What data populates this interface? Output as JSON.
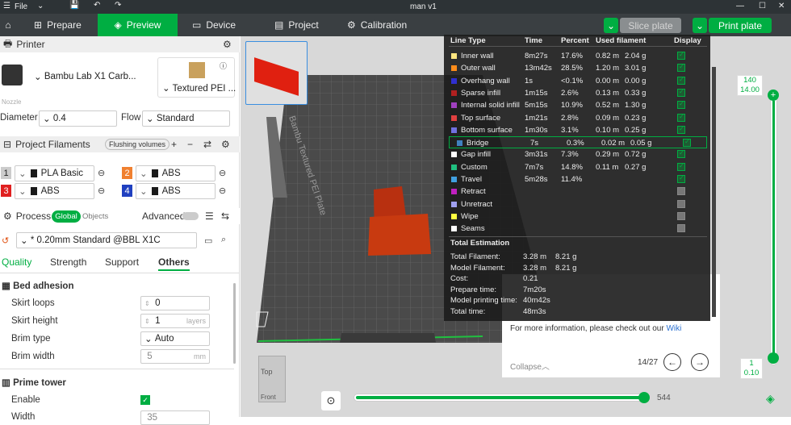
{
  "titlebar": {
    "file": "File",
    "project_name": "man v1"
  },
  "tabs": {
    "prepare": "Prepare",
    "preview": "Preview",
    "device": "Device",
    "project": "Project",
    "calibration": "Calibration"
  },
  "actions": {
    "slice": "Slice plate",
    "print": "Print plate"
  },
  "printer": {
    "section": "Printer",
    "name": "Bambu Lab X1 Carb...",
    "plate": "Textured PEI ...",
    "nozzle_label": "Nozzle",
    "diameter_label": "Diameter",
    "diameter": "0.4",
    "flow_label": "Flow",
    "flow": "Standard"
  },
  "filaments": {
    "section": "Project Filaments",
    "flushing": "Flushing volumes",
    "items": [
      {
        "num": "1",
        "name": "PLA Basic",
        "color": "#1a1a1a",
        "numbg": "#cccccc",
        "numfg": "#222222"
      },
      {
        "num": "2",
        "name": "ABS",
        "color": "#1a1a1a",
        "numbg": "#f08030",
        "numfg": "#ffffff"
      },
      {
        "num": "3",
        "name": "ABS",
        "color": "#1a1a1a",
        "numbg": "#e02020",
        "numfg": "#ffffff"
      },
      {
        "num": "4",
        "name": "ABS",
        "color": "#1a1a1a",
        "numbg": "#2040c0",
        "numfg": "#ffffff"
      }
    ]
  },
  "process": {
    "section": "Process",
    "global": "Global",
    "objects": "Objects",
    "advanced": "Advanced",
    "profile": "* 0.20mm Standard @BBL X1C",
    "tabs": [
      "Quality",
      "Strength",
      "Support",
      "Others"
    ]
  },
  "bed": {
    "section": "Bed adhesion",
    "skirt_loops_label": "Skirt loops",
    "skirt_loops": "0",
    "skirt_height_label": "Skirt height",
    "skirt_height": "1",
    "skirt_height_unit": "layers",
    "brim_type_label": "Brim type",
    "brim_type": "Auto",
    "brim_width_label": "Brim width",
    "brim_width": "5",
    "brim_width_unit": "mm"
  },
  "prime": {
    "section": "Prime tower",
    "enable_label": "Enable",
    "width_label": "Width",
    "width": "35"
  },
  "plate_label": "Bambu Textured PEI Plate",
  "stats": {
    "headers": [
      "Line Type",
      "Time",
      "Percent",
      "Used filament",
      "Display"
    ],
    "rows": [
      {
        "name": "Inner wall",
        "time": "8m27s",
        "pct": "17.6%",
        "len": "0.82 m",
        "g": "2.04 g",
        "color": "#ffe680"
      },
      {
        "name": "Outer wall",
        "time": "13m42s",
        "pct": "28.5%",
        "len": "1.20 m",
        "g": "3.01 g",
        "color": "#ff8c1a"
      },
      {
        "name": "Overhang wall",
        "time": "1s",
        "pct": "<0.1%",
        "len": "0.00 m",
        "g": "0.00 g",
        "color": "#3030d0"
      },
      {
        "name": "Sparse infill",
        "time": "1m15s",
        "pct": "2.6%",
        "len": "0.13 m",
        "g": "0.33 g",
        "color": "#b02020"
      },
      {
        "name": "Internal solid infill",
        "time": "5m15s",
        "pct": "10.9%",
        "len": "0.52 m",
        "g": "1.30 g",
        "color": "#a040c0"
      },
      {
        "name": "Top surface",
        "time": "1m21s",
        "pct": "2.8%",
        "len": "0.09 m",
        "g": "0.23 g",
        "color": "#e04040"
      },
      {
        "name": "Bottom surface",
        "time": "1m30s",
        "pct": "3.1%",
        "len": "0.10 m",
        "g": "0.25 g",
        "color": "#7070e0"
      },
      {
        "name": "Bridge",
        "time": "7s",
        "pct": "0.3%",
        "len": "0.02 m",
        "g": "0.05 g",
        "color": "#4080c0"
      },
      {
        "name": "Gap infill",
        "time": "3m31s",
        "pct": "7.3%",
        "len": "0.29 m",
        "g": "0.72 g",
        "color": "#ffffff"
      },
      {
        "name": "Custom",
        "time": "7m7s",
        "pct": "14.8%",
        "len": "0.11 m",
        "g": "0.27 g",
        "color": "#20c080"
      },
      {
        "name": "Travel",
        "time": "5m28s",
        "pct": "11.4%",
        "len": "",
        "g": "",
        "color": "#40a0e0"
      },
      {
        "name": "Retract",
        "time": "",
        "pct": "",
        "len": "",
        "g": "",
        "color": "#c020c0"
      },
      {
        "name": "Unretract",
        "time": "",
        "pct": "",
        "len": "",
        "g": "",
        "color": "#a0a0f0"
      },
      {
        "name": "Wipe",
        "time": "",
        "pct": "",
        "len": "",
        "g": "",
        "color": "#ffff40"
      },
      {
        "name": "Seams",
        "time": "",
        "pct": "",
        "len": "",
        "g": "",
        "color": "#ffffff"
      }
    ],
    "total_title": "Total Estimation",
    "totals": [
      {
        "label": "Total Filament:",
        "v1": "3.28 m",
        "v2": "8.21 g"
      },
      {
        "label": "Model Filament:",
        "v1": "3.28 m",
        "v2": "8.21 g"
      },
      {
        "label": "Cost:",
        "v1": "0.21",
        "v2": ""
      },
      {
        "label": "Prepare time:",
        "v1": "7m20s",
        "v2": ""
      },
      {
        "label": "Model printing time:",
        "v1": "40m42s",
        "v2": ""
      },
      {
        "label": "Total time:",
        "v1": "48m3s",
        "v2": ""
      }
    ]
  },
  "tip": {
    "more": "For more information, please check out our",
    "wiki": "Wiki",
    "collapse": "Collapse",
    "page": "14/27"
  },
  "slider": {
    "top_layer": "140",
    "top_height": "14.00",
    "bottom_layer": "1",
    "bottom_height": "0.10",
    "moves": "544"
  },
  "viewcube": {
    "top": "Top",
    "front": "Front"
  },
  "colors": {
    "accent": "#00ae42",
    "dark": "#2d3336"
  }
}
